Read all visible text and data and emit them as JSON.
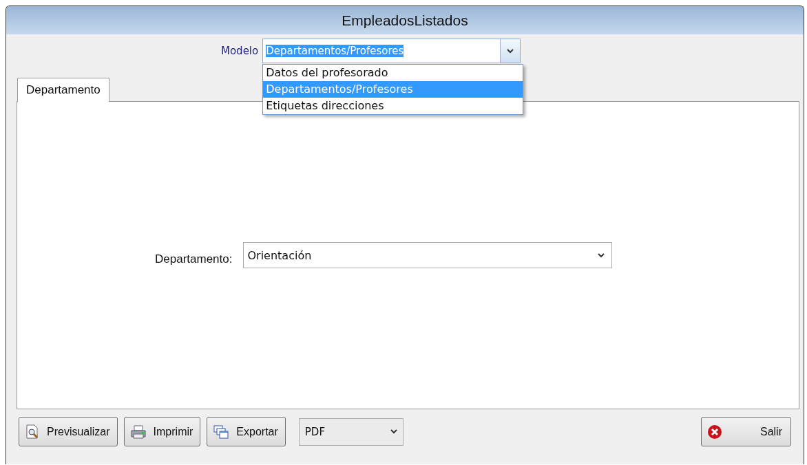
{
  "window": {
    "title": "EmpleadosListados"
  },
  "model": {
    "label": "Modelo",
    "value": "Departamentos/Profesores",
    "expanded": true,
    "options": [
      {
        "label": "Datos del profesorado",
        "selected": false
      },
      {
        "label": "Departamentos/Profesores",
        "selected": true
      },
      {
        "label": "Etiquetas direcciones",
        "selected": false
      }
    ]
  },
  "tabs": [
    {
      "label": "Departamento",
      "selected": true
    }
  ],
  "field": {
    "label": "Departamento:",
    "value": "Orientación"
  },
  "buttons": [
    {
      "label": "Previsualizar",
      "kind": "preview"
    },
    {
      "label": "Imprimir",
      "kind": "print"
    },
    {
      "label": "Exportar",
      "kind": "export"
    }
  ],
  "format": {
    "value": "PDF"
  },
  "exit_button": {
    "label": "Salir"
  }
}
